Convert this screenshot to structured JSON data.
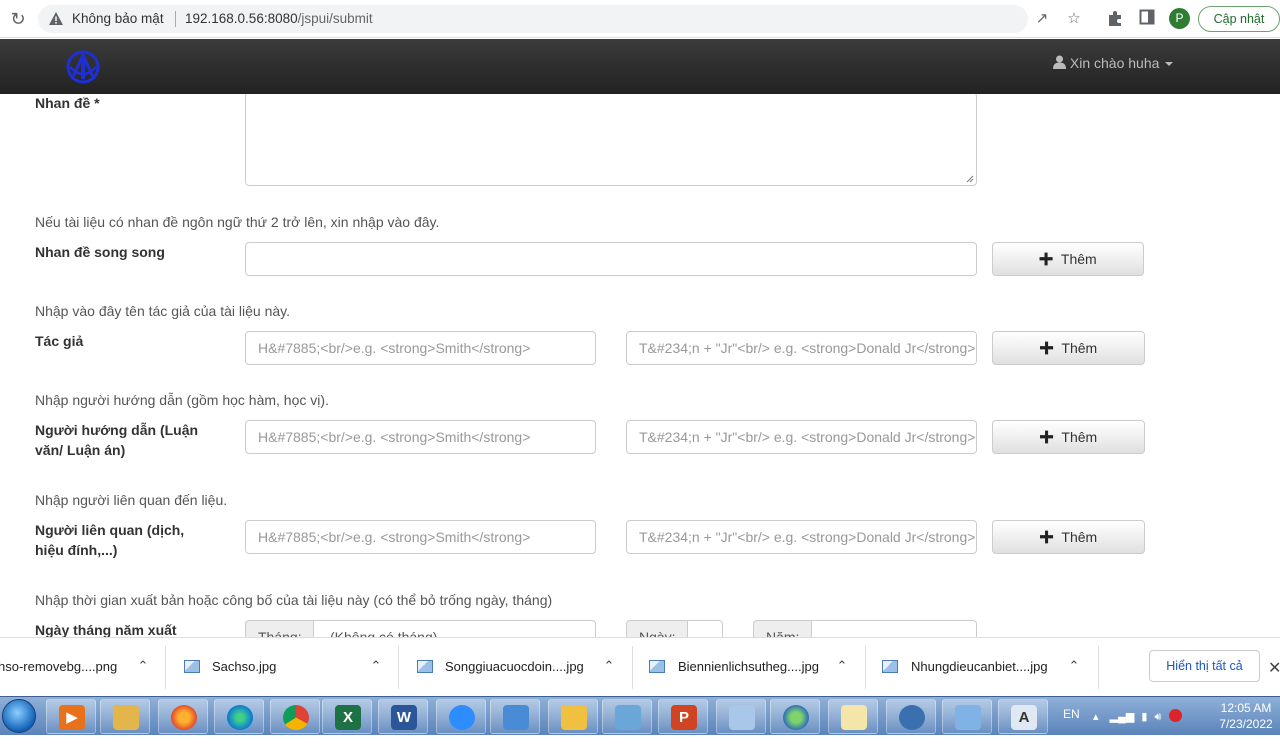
{
  "browser": {
    "not_secure": "Không bảo mật",
    "url_host": "192.168.0.56:8080",
    "url_path": "/jspui/submit",
    "profile_initial": "P",
    "update_label": "Cập nhật"
  },
  "navbar": {
    "greeting": "Xin chào huha"
  },
  "form": {
    "title_label": "Nhan đề *",
    "parallel_hint": "Nếu tài liệu có nhan đề ngôn ngữ thứ 2 trở lên, xin nhập vào đây.",
    "parallel_label": "Nhan đề song song",
    "author_hint": "Nhập vào đây tên tác giả của tài liệu này.",
    "author_label": "Tác giả",
    "advisor_hint": "Nhập người hướng dẫn (gồm học hàm, học vị).",
    "advisor_label_1": "Người hướng dẫn (Luận",
    "advisor_label_2": "văn/ Luận án)",
    "related_hint": "Nhập người liên quan đến liệu.",
    "related_label_1": "Người liên quan (dịch,",
    "related_label_2": "hiệu đính,...)",
    "date_hint": "Nhập thời gian xuất bản hoặc công bố của tài liệu này (có thể bỏ trống ngày, tháng)",
    "date_label": "Ngày tháng năm xuất",
    "month_addon": "Tháng:",
    "month_value": "(Không có tháng)",
    "day_addon": "Ngày:",
    "year_addon": "Năm:",
    "last_name_placeholder": "H&#7885;<br/>e.g. <strong>Smith</strong>",
    "first_name_placeholder": "T&#234;n + \"Jr\"<br/> e.g. <strong>Donald Jr</strong>",
    "add_label": "Thêm"
  },
  "downloads": {
    "items": [
      "hso-removebg....png",
      "Sachso.jpg",
      "Songgiuacuocdoin....jpg",
      "Biennienlichsutheg....jpg",
      "Nhungdieucanbiet....jpg"
    ],
    "show_all": "Hiển thị tất cả"
  },
  "taskbar": {
    "lang": "EN",
    "time": "12:05 AM",
    "date": "7/23/2022"
  }
}
